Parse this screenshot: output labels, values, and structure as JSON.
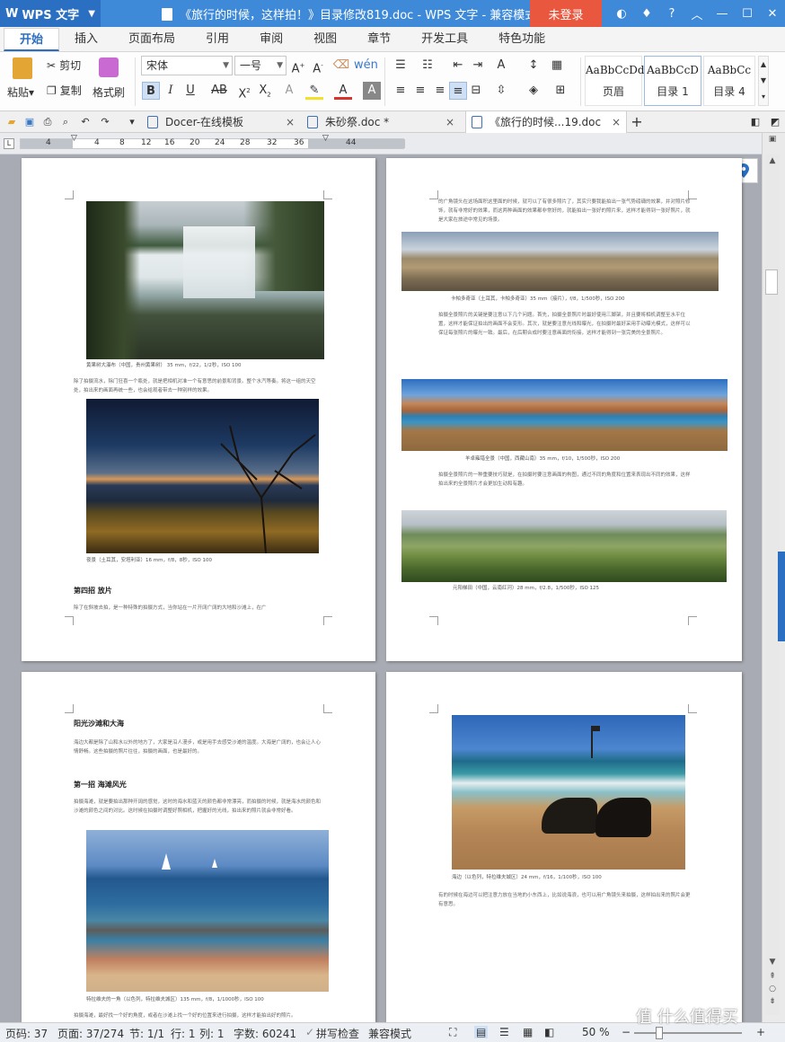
{
  "titlebar": {
    "app_name": "WPS 文字",
    "doc_title": "《旅行的时候，这样拍！》目录修改819.doc - WPS 文字 - 兼容模式",
    "login": "未登录"
  },
  "ribbon_tabs": [
    "开始",
    "插入",
    "页面布局",
    "引用",
    "审阅",
    "视图",
    "章节",
    "开发工具",
    "特色功能"
  ],
  "ribbon": {
    "paste": "粘贴",
    "cut": "剪切",
    "copy": "复制",
    "format_painter": "格式刷",
    "font_name": "宋体",
    "font_size": "一号",
    "styles": [
      {
        "sample": "AaBbCcDd",
        "name": "页眉"
      },
      {
        "sample": "AaBbCcD",
        "name": "目录 1"
      },
      {
        "sample": "AaBbCc",
        "name": "目录 4"
      }
    ]
  },
  "doc_tabs": [
    {
      "label": "Docer-在线模板"
    },
    {
      "label": "朱砂祭.doc *"
    },
    {
      "label": "《旅行的时候...19.doc"
    }
  ],
  "ruler_numbers": [
    "4",
    "4",
    "8",
    "12",
    "16",
    "20",
    "24",
    "28",
    "32",
    "36",
    "44"
  ],
  "pages": {
    "p1": {
      "cap1": "黄果树大瀑布（中国，贵州黄果树） 35 mm，f/22，1/2秒，ISO 100",
      "para1": "除了拍摄流水，除门狂喜一个瓶处，就是把相机对准一个有意思的前景和背景。整个水汽等奏。将这一组的天空处，拍出来的画面再统一些，也会给观者带去一种别样的效果。",
      "cap2": "夜景（土耳其，安塔利亚）16 mm，f/8，8秒，ISO 100",
      "heading": "第四招 放片",
      "para2": "除了在斜坡去拍，是一种特殊的拍摄方式，当你站在一片开阔广阔的大地和沙滩上，在广"
    },
    "p2": {
      "para1": "的广角镜头在这场面积这里面的时候，就可以了有很多照片了，其实只要我能拍出一张气势磅礴的效果，并对照片修饰，就有非常好的效果，而这两种画面的效果都非常好的，就能拍出一张好的照片来，这样才能得到一张好照片，就是大家在旅途中常见的场景。",
      "cap1": "卡帕多奇亚（土耳其，卡帕多奇亚）35 mm（接片），f/8，1/500秒，ISO 200",
      "para2": "拍摄全景照片的关键是要注意以下几个问题。首先，拍摄全景照片时最好使用三脚架，并且要将相机调整至水平位置，这样才能保证拍出的画面不会变形。其次，就是要注意光线和曝光，在拍摄时最好采用手动曝光模式，这样可以保证每张照片的曝光一致。最后，在后期合成时要注意画面的衔接，这样才能得到一张完美的全景照片。",
      "cap2": "羊卓雍错全景（中国，西藏山南）35 mm，f/10，1/500秒，ISO 200",
      "para3": "拍摄全景照片的一种重要技巧就是，在拍摄时要注意画面的构图，通过不同的角度和位置来表现出不同的效果，这样拍出来的全景照片才会更加生动和有趣。",
      "cap3": "元阳梯田（中国，云南红河）28 mm，f/2.8，1/500秒，ISO 125"
    },
    "p3": {
      "heading1": "阳光沙滩和大海",
      "para1": "海边大都是除了山和水以外的地方了，大家是沿人漫步，或是用手去感受沙滩的温度。大海是广阔的，也会让人心情舒畅。这些拍摄的照片往往，拍摄的画面，也是最好的。",
      "heading2": "第一招 海滩风光",
      "para2": "拍摄海滩，就是要拍出那种开阔的感觉，这时的海水和蓝天的颜色都非常漂亮，而拍摄的时候，就是海水的颜色和沙滩的颜色之间的对比。这时候在拍摄时调整好照相机，把握好的光线，拍出来的照片就会非常好看。",
      "cap1": "特拉维夫的一角（以色列，特拉维夫城区）135 mm，f/8，1/1000秒，ISO 100",
      "para3": "拍摄海滩，最好找一个好的角度，或者在沙滩上找一个好的位置来进行拍摄，这样才能拍出好的照片。"
    },
    "p4": {
      "cap1": "海边（以色列，特拉维夫城区）24 mm，f/16，1/100秒，ISO 100",
      "para1": "有的时候在海边可以把注意力放在当地的小东西上，比如说海浪，也可以用广角镜头来拍摄，这样拍出来的照片会更有意思。"
    }
  },
  "statusbar": {
    "page_num": "页码: 37",
    "page_of": "页面: 37/274",
    "section": "节: 1/1",
    "row": "行: 1",
    "col": "列: 1",
    "word_count": "字数: 60241",
    "spell_check": "拼写检查",
    "compat": "兼容模式",
    "zoom": "50 %"
  },
  "watermark": "值 什么值得买",
  "colors": {
    "accent": "#2b6fc2",
    "titlebar": "#3f8ad8",
    "login": "#e9573f"
  }
}
